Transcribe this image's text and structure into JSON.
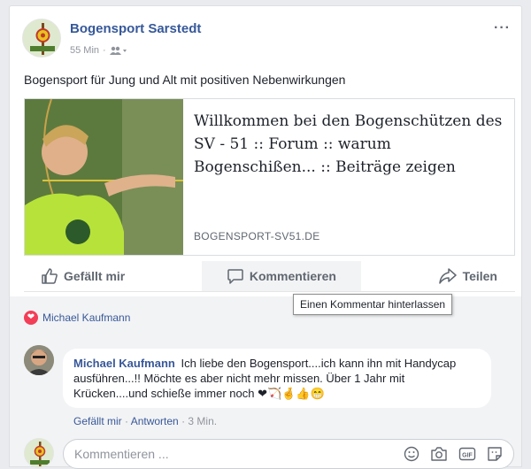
{
  "post": {
    "page_name": "Bogensport Sarstedt",
    "time": "55 Min",
    "audience_icon": "friends-icon",
    "text": "Bogensport für Jung und Alt mit positiven Nebenwirkungen"
  },
  "link": {
    "title": "Willkommen bei den Bogenschützen des SV - 51 :: Forum :: warum Bogenschißen... :: Beiträge zeigen",
    "domain": "BOGENSPORT-SV51.DE"
  },
  "actions": {
    "like": "Gefällt mir",
    "comment": "Kommentieren",
    "share": "Teilen"
  },
  "tooltip": "Einen Kommentar hinterlassen",
  "reactions": {
    "names": "Michael Kaufmann",
    "icon": "heart-icon",
    "color": "#f33e58"
  },
  "comment": {
    "author": "Michael Kaufmann",
    "text": "Ich liebe den Bogensport....ich kann ihn mit Handycap ausführen...!! Möchte es aber nicht mehr missen. Über 1 Jahr mit Krücken....und schieße immer noch",
    "emojis": "❤🏹🤞👍😁",
    "like": "Gefällt mir",
    "reply": "Antworten",
    "separator": "·",
    "time": "3 Min."
  },
  "compose": {
    "placeholder": "Kommentieren ..."
  },
  "colors": {
    "link": "#365899",
    "background": "#e9ebee",
    "secondary_text": "#90949c"
  }
}
